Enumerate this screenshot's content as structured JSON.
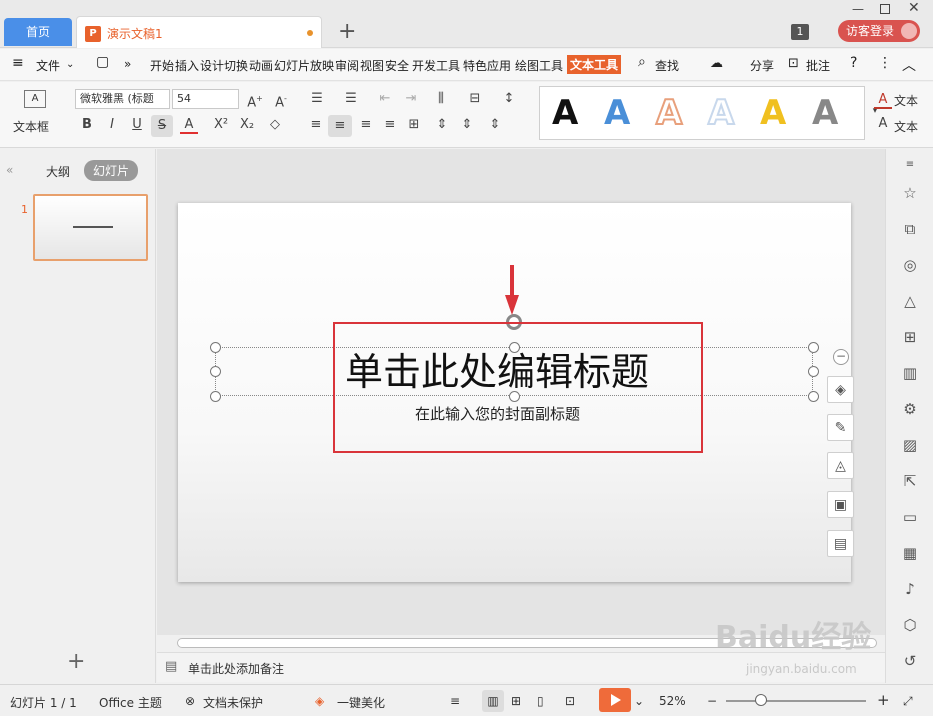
{
  "tabs": {
    "home": "首页",
    "doc": "演示文稿1",
    "count": "1",
    "login": "访客登录"
  },
  "menu": {
    "file": "文件",
    "items": [
      "开始",
      "插入",
      "设计",
      "切换",
      "动画",
      "幻灯片放映",
      "审阅",
      "视图",
      "安全",
      "开发工具",
      "特色应用",
      "绘图工具"
    ],
    "active": "文本工具",
    "search": "查找",
    "share": "分享",
    "comment": "批注"
  },
  "ribbon": {
    "textbox": "文本框",
    "font": "微软雅黑 (标题",
    "size": "54",
    "text_fill": "文本",
    "text_outline": "文本",
    "wordart": [
      {
        "letter": "A",
        "color": "#111111"
      },
      {
        "letter": "A",
        "color": "#4a8fd8"
      },
      {
        "letter": "A",
        "color": "#e8a07c"
      },
      {
        "letter": "A",
        "color": "#c8d8ec"
      },
      {
        "letter": "A",
        "color": "#f0c020"
      },
      {
        "letter": "A",
        "color": "#888888"
      }
    ]
  },
  "left": {
    "outline": "大纲",
    "slides": "幻灯片",
    "slide_num": "1"
  },
  "slide": {
    "title": "单击此处编辑标题",
    "subtitle": "在此输入您的封面副标题"
  },
  "notes": {
    "placeholder": "单击此处添加备注"
  },
  "status": {
    "slide": "幻灯片 1 / 1",
    "theme": "Office 主题",
    "protect": "文档未保护",
    "beautify": "一键美化",
    "zoom": "52%"
  },
  "watermark": {
    "logo": "Baidu经验",
    "url": "jingyan.baidu.com"
  },
  "colors": {
    "accent": "#e8622c",
    "tab_blue": "#4a8fe8",
    "highlight": "#d9343a"
  }
}
